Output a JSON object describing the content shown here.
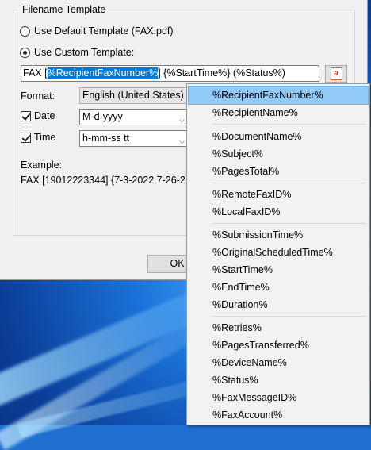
{
  "group": {
    "title": "Filename Template"
  },
  "options": {
    "default_label": "Use Default Template (FAX.pdf)",
    "custom_label": "Use Custom Template:"
  },
  "template": {
    "prefix": "FAX [",
    "selected": "%RecipientFaxNumber%",
    "suffix": "] {%StartTime%} (%Status%)"
  },
  "format": {
    "label": "Format:",
    "value": "English (United States)"
  },
  "date": {
    "label": "Date",
    "value": "M-d-yyyy",
    "checked": true
  },
  "time": {
    "label": "Time",
    "value": "h-mm-ss tt",
    "checked": true
  },
  "example": {
    "label": "Example:",
    "value": "FAX [19012223344] {7-3-2022 7-26-2"
  },
  "buttons": {
    "ok": "OK"
  },
  "menu": {
    "items": [
      "%RecipientFaxNumber%",
      "%RecipientName%",
      "%DocumentName%",
      "%Subject%",
      "%PagesTotal%",
      "%RemoteFaxID%",
      "%LocalFaxID%",
      "%SubmissionTime%",
      "%OriginalScheduledTime%",
      "%StartTime%",
      "%EndTime%",
      "%Duration%",
      "%Retries%",
      "%PagesTransferred%",
      "%DeviceName%",
      "%Status%",
      "%FaxMessageID%",
      "%FaxAccount%"
    ],
    "highlighted_index": 0
  },
  "icons": {
    "insert": "insert-field-icon"
  },
  "colors": {
    "selection": "#0078d7",
    "menu_highlight": "#91c9f7"
  }
}
